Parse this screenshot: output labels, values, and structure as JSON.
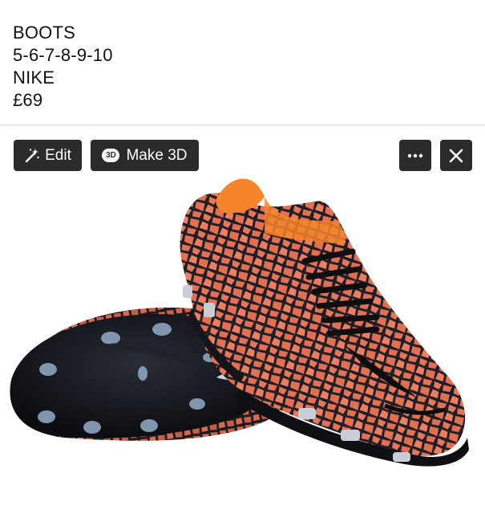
{
  "post": {
    "lines": [
      "BOOTS",
      "5-6-7-8-9-10",
      "NIKE",
      "£69"
    ]
  },
  "toolbar": {
    "edit_label": "Edit",
    "make3d_label": "Make 3D",
    "make3d_badge": "3D",
    "more_icon": "ellipsis-icon",
    "close_icon": "close-icon"
  },
  "photo": {
    "subject": "football-boots",
    "colors": {
      "base": "#1d1f24",
      "pattern": "#e9765a",
      "collar": "#f5852a",
      "laces": "#0f0f10"
    }
  }
}
